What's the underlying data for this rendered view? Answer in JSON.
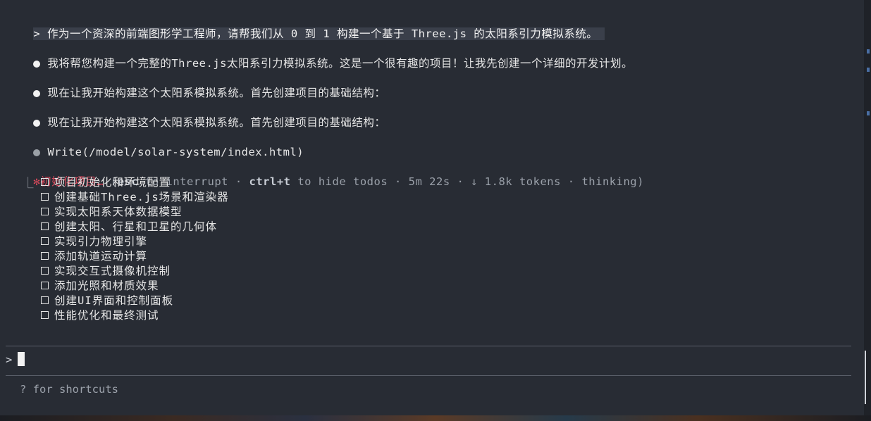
{
  "conversation": {
    "user_prompt": "> 作为一个资深的前端图形学工程师，请帮我们从 0 到 1 构建一个基于 Three.js 的太阳系引力模拟系统。",
    "messages": [
      "我将帮您构建一个完整的Three.js太阳系引力模拟系统。这是一个很有趣的项目！让我先创建一个详细的开发计划。",
      "现在让我开始构建这个太阳系模拟系统。首先创建项目的基础结构：",
      "现在让我开始构建这个太阳系模拟系统。首先创建项目的基础结构："
    ],
    "tool_call": "Write(/model/solar-system/index.html)"
  },
  "status": {
    "star": "✻",
    "title": "初始化项目…",
    "open_paren": "(",
    "esc_key": "esc",
    "esc_text": " to interrupt · ",
    "ctrl_key": "ctrl+t",
    "ctrl_text": " to hide todos · 5m 22s · ↓ 1.8k tokens · thinking)"
  },
  "todos": {
    "branch": "⎿",
    "items": [
      "项目初始化和环境配置",
      "创建基础Three.js场景和渲染器",
      "实现太阳系天体数据模型",
      "创建太阳、行星和卫星的几何体",
      "实现引力物理引擎",
      "添加轨道运动计算",
      "实现交互式摄像机控制",
      "添加光照和材质效果",
      "创建UI界面和控制面板",
      "性能优化和最终测试"
    ]
  },
  "input": {
    "prompt_symbol": ">",
    "value": ""
  },
  "footer": {
    "hint": "? for shortcuts"
  }
}
